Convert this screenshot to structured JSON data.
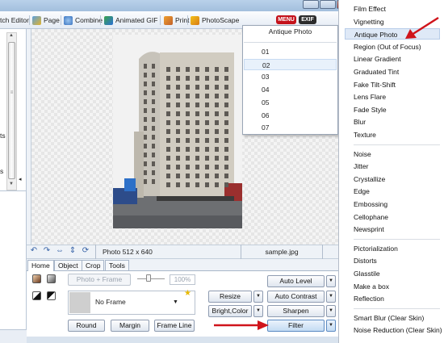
{
  "toolbar": {
    "items": [
      "tch Editor",
      "Page",
      "Combine",
      "Animated GIF",
      "Print",
      "PhotoScape"
    ],
    "menu_pill": "MENU",
    "exif_pill": "EXIF"
  },
  "left_panel": {
    "text_ts": "ts",
    "text_s": "s"
  },
  "canvas": {
    "photo_size": "Photo 512 x 640",
    "filename": "sample.jpg"
  },
  "tabs": [
    "Home",
    "Object",
    "Crop",
    "Tools"
  ],
  "home_panel": {
    "photo_frame_label": "Photo + Frame",
    "zoom_percent": "100%",
    "frame_value": "No Frame",
    "round_label": "Round",
    "margin_label": "Margin",
    "frame_line_label": "Frame Line",
    "resize_label": "Resize",
    "bright_color_label": "Bright,Color",
    "auto_level_label": "Auto Level",
    "auto_contrast_label": "Auto Contrast",
    "sharpen_label": "Sharpen",
    "filter_label": "Filter"
  },
  "popup": {
    "title": "Antique Photo",
    "options": [
      "01",
      "02",
      "03",
      "04",
      "05",
      "06",
      "07"
    ],
    "selected_index": 1
  },
  "filter_menu": {
    "groups": [
      [
        "Film Effect",
        "Vignetting",
        "Antique Photo",
        "Region (Out of Focus)",
        "Linear Gradient",
        "Graduated Tint",
        "Fake Tilt-Shift",
        "Lens Flare",
        "Fade Style",
        "Blur",
        "Texture"
      ],
      [
        "Noise",
        "Jitter",
        "Crystallize",
        "Edge",
        "Embossing",
        "Cellophane",
        "Newsprint"
      ],
      [
        "Pictorialization",
        "Distorts",
        "Glasstile",
        "Make a box",
        "Reflection"
      ],
      [
        "Smart Blur (Clear Skin)",
        "Noise Reduction (Clear Skin)"
      ]
    ],
    "highlighted": "Antique Photo"
  },
  "colors": {
    "accent_red": "#d0141b",
    "menu_highlight": "#dfe9f7",
    "title_bar": "#b9d1ea"
  }
}
